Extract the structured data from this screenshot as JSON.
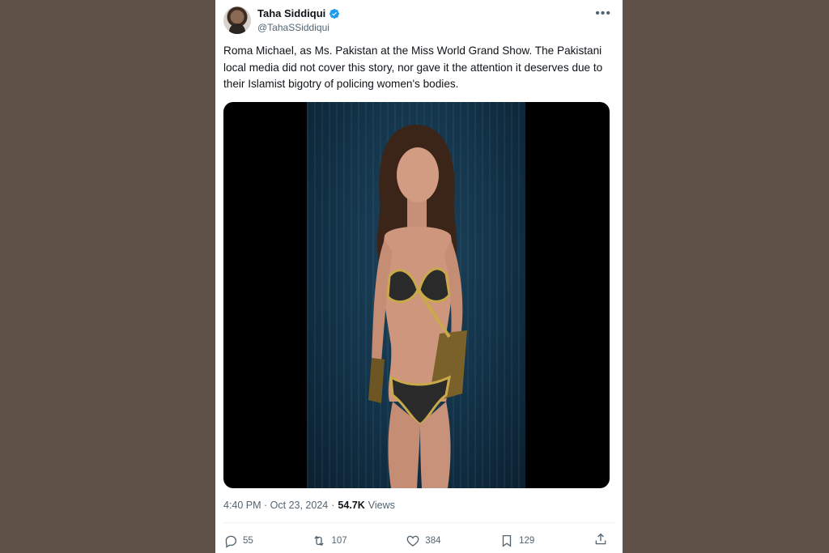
{
  "tweet": {
    "author": {
      "display_name": "Taha Siddiqui",
      "handle": "@TahaSSiddiqui",
      "verified": true
    },
    "text": "Roma Michael, as Ms. Pakistan at the Miss World Grand Show. The Pakistani local media did not cover this story, nor gave it the attention it deserves due to their Islamist bigotry of policing women's bodies.",
    "timestamp": "4:40 PM · Oct 23, 2024",
    "separator": "·",
    "views_count": "54.7K",
    "views_label": "Views",
    "actions": {
      "replies": "55",
      "retweets": "107",
      "likes": "384",
      "bookmarks": "129"
    }
  },
  "icons": {
    "more": "more-icon",
    "verified": "verified-badge-icon",
    "reply": "reply-icon",
    "retweet": "retweet-icon",
    "like": "heart-icon",
    "bookmark": "bookmark-icon",
    "share": "share-icon"
  },
  "colors": {
    "background": "#5f5048",
    "card": "#ffffff",
    "text_primary": "#0f1419",
    "text_secondary": "#536471",
    "verified_blue": "#1d9bf0"
  }
}
